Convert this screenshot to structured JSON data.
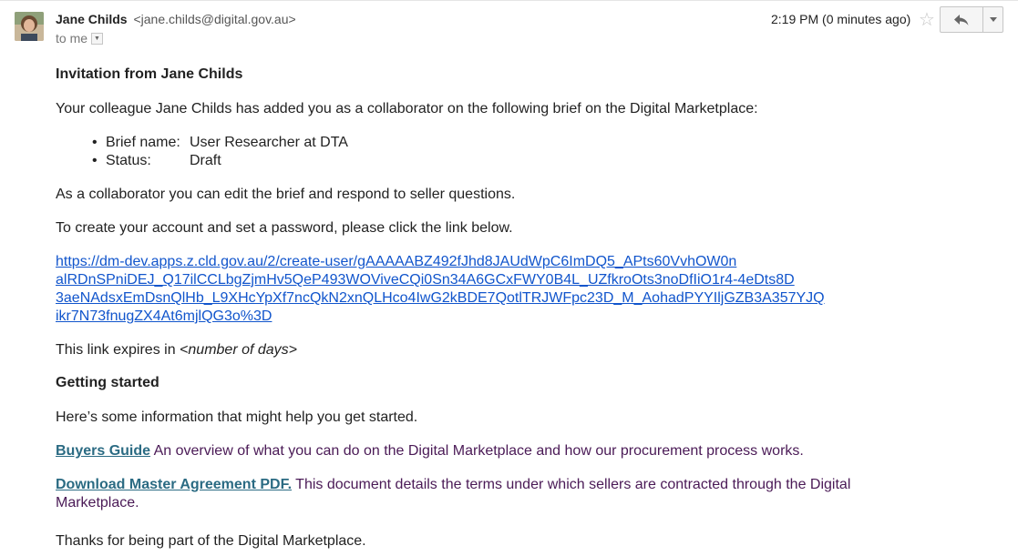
{
  "header": {
    "sender_name": "Jane Childs",
    "sender_email": "<jane.childs@digital.gov.au>",
    "to_label": "to me",
    "timestamp": "2:19 PM (0 minutes ago)",
    "icons": [
      "avatar",
      "star-icon",
      "reply-icon",
      "chevron-down-icon"
    ]
  },
  "email": {
    "heading": "Invitation from Jane Childs",
    "intro": "Your colleague Jane Childs has added you as a collaborator on the following brief on the Digital Marketplace:",
    "brief": {
      "name_label": "Brief name:",
      "name_value": "User Researcher at DTA",
      "status_label": "Status:",
      "status_value": "Draft"
    },
    "edit_text": "As a collaborator you can edit the brief and respond to seller questions.",
    "create_text": "To create your account and set a password, please click the link below.",
    "link_lines": [
      "https://dm-dev.apps.z.cld.gov.au/2/create-user/gAAAAABZ492fJhd8JAUdWpC6ImDQ5_APts60VvhOW0n",
      "alRDnSPniDEJ_Q17ilCCLbgZjmHv5QeP493WOViveCQi0Sn34A6GCxFWY0B4L_UZfkroOts3noDfIiO1r4-4eDts8D",
      "3aeNAdsxEmDsnQlHb_L9XHcYpXf7ncQkN2xnQLHco4IwG2kBDE7QotlTRJWFpc23D_M_AohadPYYIljGZB3A357YJQ",
      "ikr7N73fnugZX4At6mjlQG3o%3D"
    ],
    "expires_prefix": "This link expires in ",
    "expires_placeholder": "<number of days>",
    "getting_started_heading": "Getting started",
    "info_text": "Here’s some information that might help you get started.",
    "buyers_guide_link": "Buyers Guide",
    "buyers_guide_text": " An overview of what you can do on the Digital Marketplace and how our procurement process works.",
    "master_agreement_link": "Download Master Agreement PDF.",
    "master_agreement_text": " This document details the terms under which sellers are contracted through the Digital Marketplace.",
    "thanks_text": "Thanks for being part of the Digital Marketplace."
  }
}
